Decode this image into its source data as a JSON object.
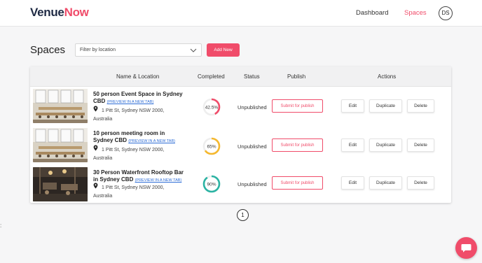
{
  "header": {
    "logo_part1": "Venue",
    "logo_part2": "Now",
    "nav": [
      {
        "label": "Dashboard",
        "active": false
      },
      {
        "label": "Spaces",
        "active": true
      }
    ],
    "avatar_initials": "DS"
  },
  "main": {
    "title": "Spaces",
    "filter_placeholder": "Filter by location",
    "add_button": "Add New"
  },
  "table": {
    "columns": [
      "Name & Location",
      "Completed",
      "Status",
      "Publish",
      "Actions"
    ],
    "rows": [
      {
        "title": "50 person Event Space in Sydney CBD",
        "preview_link": "(PREVIEW IN A NEW TAB)",
        "address_line1": "1 Pitt St, Sydney NSW 2000,",
        "address_line2": "Australia",
        "completed_label": "42.5%",
        "completed_fraction": 0.425,
        "completed_color": "#f04c6a",
        "status": "Unpublished",
        "publish_label": "Submit for publish",
        "actions": [
          "Edit",
          "Duplicate",
          "Delete"
        ]
      },
      {
        "title": "10 person meeting room in Sydney CBD",
        "preview_link": "(PREVIEW IN A NEW TAB)",
        "address_line1": "1 Pitt St, Sydney NSW 2000,",
        "address_line2": "Australia",
        "completed_label": "65%",
        "completed_fraction": 0.65,
        "completed_color": "#f5b82e",
        "status": "Unpublished",
        "publish_label": "Submit for publish",
        "actions": [
          "Edit",
          "Duplicate",
          "Delete"
        ]
      },
      {
        "title": "30 Person Waterfront Rooftop Bar in Sydney CBD",
        "preview_link": "(PREVIEW IN A NEW TAB)",
        "address_line1": "1 Pitt St, Sydney NSW 2000,",
        "address_line2": "Australia",
        "completed_label": "90%",
        "completed_fraction": 0.9,
        "completed_color": "#2bb3a3",
        "status": "Unpublished",
        "publish_label": "Submit for publish",
        "actions": [
          "Edit",
          "Duplicate",
          "Delete"
        ]
      }
    ]
  },
  "pagination": {
    "current_page": "1"
  },
  "icons": {
    "filter_chevron": "chevron-down-icon",
    "address_pin": "map-pin-icon",
    "chat": "chat-bubble-icon"
  },
  "colors": {
    "brand_accent": "#f04c6a",
    "logo_dark": "#1f2a44"
  }
}
